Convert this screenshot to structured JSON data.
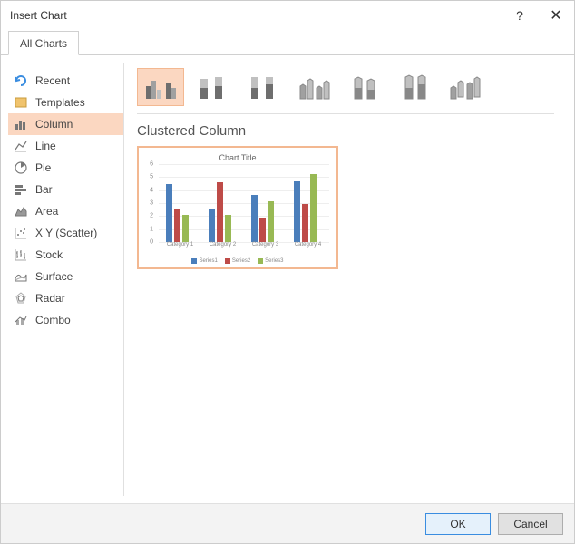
{
  "dialog": {
    "title": "Insert Chart",
    "help": "?",
    "close": "✕"
  },
  "tabs": {
    "all": "All Charts"
  },
  "sidebar": {
    "items": [
      {
        "label": "Recent"
      },
      {
        "label": "Templates"
      },
      {
        "label": "Column"
      },
      {
        "label": "Line"
      },
      {
        "label": "Pie"
      },
      {
        "label": "Bar"
      },
      {
        "label": "Area"
      },
      {
        "label": "X Y (Scatter)"
      },
      {
        "label": "Stock"
      },
      {
        "label": "Surface"
      },
      {
        "label": "Radar"
      },
      {
        "label": "Combo"
      }
    ]
  },
  "subtype_title": "Clustered Column",
  "buttons": {
    "ok": "OK",
    "cancel": "Cancel"
  },
  "colors": {
    "series1": "#4a7ebb",
    "series2": "#be4b48",
    "series3": "#98b954",
    "accent_fill": "#fbd7c1",
    "accent_border": "#f3b891"
  },
  "chart_data": {
    "type": "bar",
    "title": "Chart Title",
    "categories": [
      "Category 1",
      "Category 2",
      "Category 3",
      "Category 4"
    ],
    "series": [
      {
        "name": "Series1",
        "values": [
          4.3,
          2.5,
          3.5,
          4.5
        ]
      },
      {
        "name": "Series2",
        "values": [
          2.4,
          4.4,
          1.8,
          2.8
        ]
      },
      {
        "name": "Series3",
        "values": [
          2.0,
          2.0,
          3.0,
          5.0
        ]
      }
    ],
    "ylim": [
      0,
      6
    ],
    "yticks": [
      0,
      1,
      2,
      3,
      4,
      5,
      6
    ],
    "xlabel": "",
    "ylabel": "",
    "legend_position": "bottom"
  }
}
